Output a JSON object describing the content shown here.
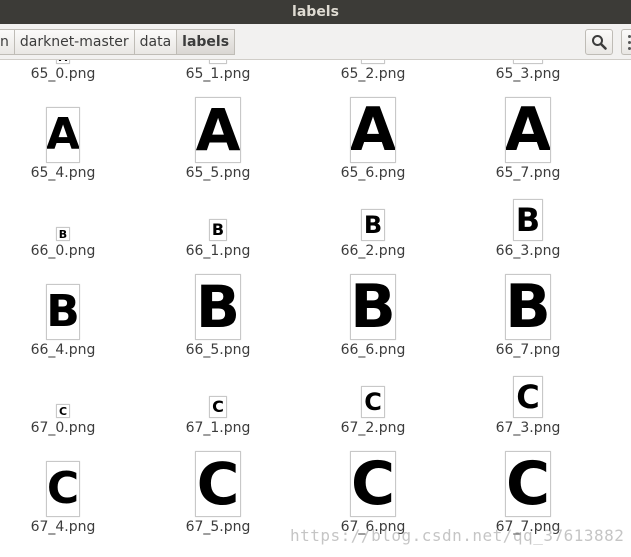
{
  "window": {
    "title": "labels"
  },
  "breadcrumbs": [
    {
      "label": "n"
    },
    {
      "label": "darknet-master"
    },
    {
      "label": "data"
    },
    {
      "label": "labels"
    }
  ],
  "toolbar": {
    "search_icon": "magnifier-icon",
    "more_icon": "vertical-dots-icon"
  },
  "files": [
    {
      "name": "65_0.png",
      "letter": "A",
      "level": 0
    },
    {
      "name": "65_1.png",
      "letter": "A",
      "level": 1
    },
    {
      "name": "65_2.png",
      "letter": "A",
      "level": 2
    },
    {
      "name": "65_3.png",
      "letter": "A",
      "level": 3
    },
    {
      "name": "65_4.png",
      "letter": "A",
      "level": 4
    },
    {
      "name": "65_5.png",
      "letter": "A",
      "level": 5
    },
    {
      "name": "65_6.png",
      "letter": "A",
      "level": 6
    },
    {
      "name": "65_7.png",
      "letter": "A",
      "level": 7
    },
    {
      "name": "66_0.png",
      "letter": "B",
      "level": 0
    },
    {
      "name": "66_1.png",
      "letter": "B",
      "level": 1
    },
    {
      "name": "66_2.png",
      "letter": "B",
      "level": 2
    },
    {
      "name": "66_3.png",
      "letter": "B",
      "level": 3
    },
    {
      "name": "66_4.png",
      "letter": "B",
      "level": 4
    },
    {
      "name": "66_5.png",
      "letter": "B",
      "level": 5
    },
    {
      "name": "66_6.png",
      "letter": "B",
      "level": 6
    },
    {
      "name": "66_7.png",
      "letter": "B",
      "level": 7
    },
    {
      "name": "67_0.png",
      "letter": "C",
      "level": 0
    },
    {
      "name": "67_1.png",
      "letter": "C",
      "level": 1
    },
    {
      "name": "67_2.png",
      "letter": "C",
      "level": 2
    },
    {
      "name": "67_3.png",
      "letter": "C",
      "level": 3
    },
    {
      "name": "67_4.png",
      "letter": "C",
      "level": 4
    },
    {
      "name": "67_5.png",
      "letter": "C",
      "level": 5
    },
    {
      "name": "67_6.png",
      "letter": "C",
      "level": 6
    },
    {
      "name": "67_7.png",
      "letter": "C",
      "level": 7
    }
  ],
  "watermark": {
    "text": "https://blog.csdn.net/qq_37613882"
  }
}
